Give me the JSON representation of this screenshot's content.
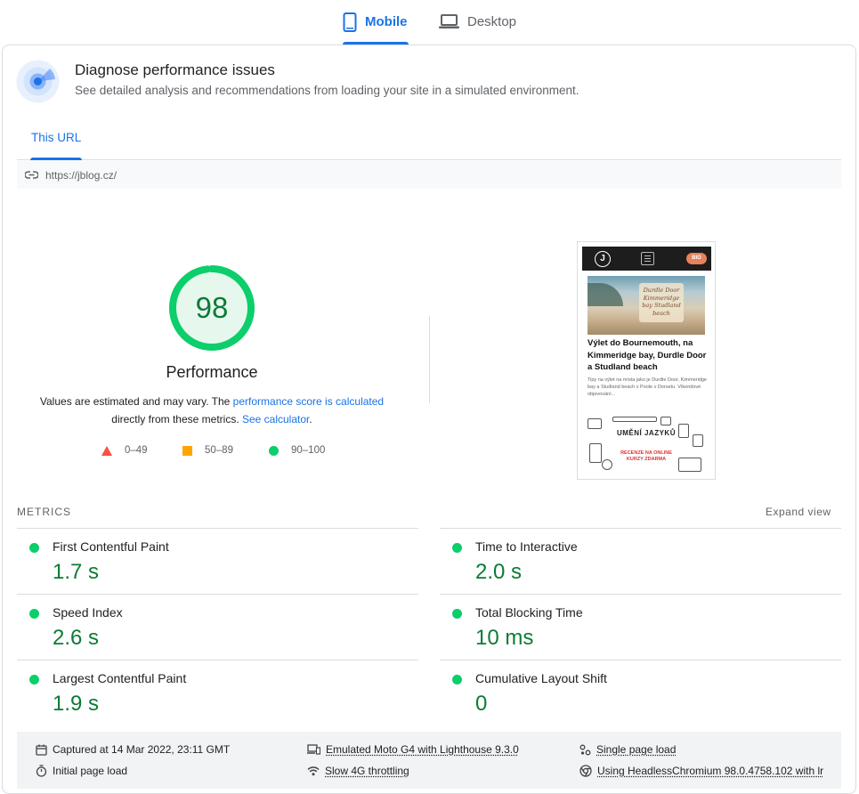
{
  "device_tabs": {
    "mobile": "Mobile",
    "desktop": "Desktop"
  },
  "header": {
    "title": "Diagnose performance issues",
    "subtitle": "See detailed analysis and recommendations from loading your site in a simulated environment."
  },
  "url_tab": "This URL",
  "url": "https://jblog.cz/",
  "performance": {
    "score": "98",
    "score_fraction": 0.98,
    "label": "Performance",
    "note_prefix": "Values are estimated and may vary. The ",
    "note_link1": "performance score is calculated",
    "note_middle": " directly from these metrics. ",
    "note_link2": "See calculator",
    "note_suffix": "."
  },
  "legend": {
    "fail": "0–49",
    "average": "50–89",
    "pass": "90–100",
    "colors": {
      "fail": "#ff4e42",
      "average": "#ffa400",
      "pass": "#0cce6b"
    }
  },
  "thumbnail": {
    "logo": "J",
    "badge": "BIO",
    "image_text": "Durdle Door Kimmeridge bay Studland beach",
    "title": "Výlet do Bournemouth, na Kimmeridge bay, Durdle Door a Studland beach",
    "excerpt": "Tipy na výlet na místa jako je Durdle Door, Kimmeridge bay a Studland beach v Poole v Dorsetu. Víkendové objevování...",
    "ad_title": "UMĚNÍ JAZYKŮ",
    "ad_sub": "RECENZE NA ONLINE KURZY ZDARMA"
  },
  "metrics_section": {
    "label": "METRICS",
    "expand": "Expand view"
  },
  "metrics": [
    {
      "name": "First Contentful Paint",
      "value": "1.7 s"
    },
    {
      "name": "Time to Interactive",
      "value": "2.0 s"
    },
    {
      "name": "Speed Index",
      "value": "2.6 s"
    },
    {
      "name": "Total Blocking Time",
      "value": "10 ms"
    },
    {
      "name": "Largest Contentful Paint",
      "value": "1.9 s"
    },
    {
      "name": "Cumulative Layout Shift",
      "value": "0"
    }
  ],
  "footer": {
    "captured": "Captured at 14 Mar 2022, 23:11 GMT",
    "initial": "Initial page load",
    "device": "Emulated Moto G4 with Lighthouse 9.3.0",
    "throttling": "Slow 4G throttling",
    "session": "Single page load",
    "browser": "Using HeadlessChromium 98.0.4758.102 with lr"
  },
  "colors": {
    "accent": "#1a73e8",
    "pass_text": "#0c7b36",
    "pass": "#0cce6b"
  }
}
